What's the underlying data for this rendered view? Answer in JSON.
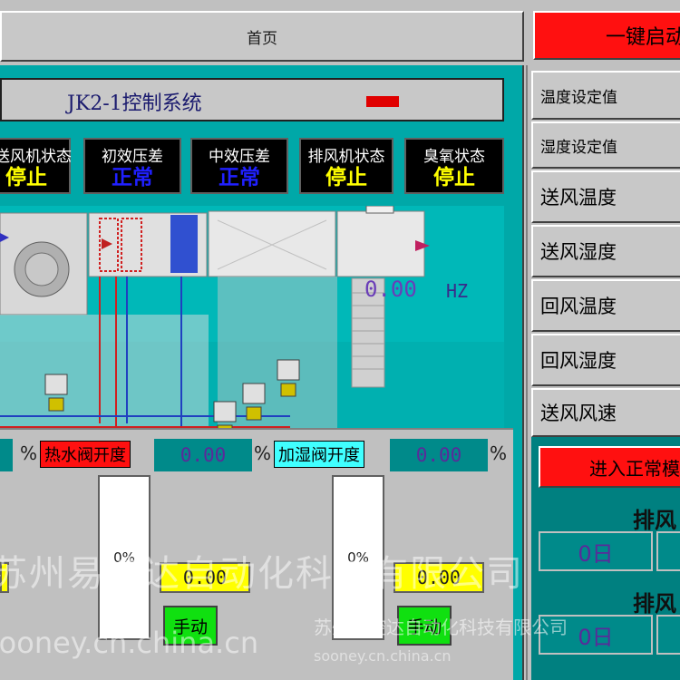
{
  "header": {
    "home_tab": "首页",
    "one_click_start": "一键启动"
  },
  "system": {
    "title": "JK2-1控制系统"
  },
  "status": [
    {
      "label": "送风机状态",
      "value": "停止"
    },
    {
      "label": "初效压差",
      "value": "正常"
    },
    {
      "label": "中效压差",
      "value": "正常"
    },
    {
      "label": "排风机状态",
      "value": "停止"
    },
    {
      "label": "臭氧状态",
      "value": "停止"
    }
  ],
  "schematic": {
    "freq_value": "0.00",
    "freq_unit": "HZ"
  },
  "valves": {
    "percent_symbol": "%",
    "hot_water": {
      "label": "热水阀开度",
      "value": "0.00"
    },
    "humidify": {
      "label": "加湿阀开度",
      "value": "0.00"
    },
    "bar1_text": "0%",
    "bar2_text": "0%",
    "setpoint1": "0.00",
    "setpoint2": "0.00",
    "mode1": "手动",
    "mode2": "手动"
  },
  "params": [
    {
      "label": "温度设定值"
    },
    {
      "label": "湿度设定值"
    },
    {
      "label": "送风温度"
    },
    {
      "label": "送风湿度"
    },
    {
      "label": "回风温度"
    },
    {
      "label": "回风湿度"
    },
    {
      "label": "送风风速"
    }
  ],
  "exhaust": {
    "enter_normal": "进入正常模式",
    "title1": "排风",
    "title2": "排风",
    "day1": "0日",
    "day2": "0日"
  },
  "watermark": {
    "cn": "苏州易控达自动化科技有限公司",
    "en": "sooney.cn.china.cn"
  },
  "colors": {
    "teal": "#00a8a8",
    "alarm_red": "#ff1010",
    "status_yellow": "#ffff00",
    "status_blue": "#2020ff",
    "manual_green": "#10e010"
  }
}
